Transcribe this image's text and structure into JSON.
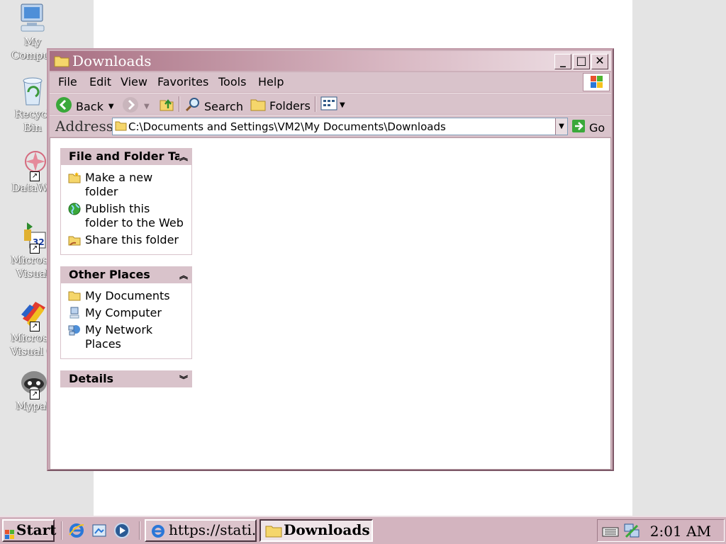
{
  "desktop": {
    "icons": [
      {
        "label": "My\nComput",
        "icon": "my-computer-icon"
      },
      {
        "label": "Recycl\nBin",
        "icon": "recycle-bin-icon"
      },
      {
        "label": "DataWa",
        "icon": "datawatch-icon"
      },
      {
        "label": "Microso\nVisual",
        "icon": "visual-studio-icon"
      },
      {
        "label": "Microso\nVisual C",
        "icon": "visual-c-icon"
      },
      {
        "label": "Mypal",
        "icon": "mypal-raccoon-icon"
      }
    ]
  },
  "window": {
    "title": "Downloads",
    "controls": {
      "minimize": "_",
      "maximize": "□",
      "close": "✕"
    },
    "menu": [
      "File",
      "Edit",
      "View",
      "Favorites",
      "Tools",
      "Help"
    ],
    "toolbar": {
      "back": "Back",
      "search": "Search",
      "folders": "Folders"
    },
    "address": {
      "label": "Address",
      "value": "C:\\Documents and Settings\\VM2\\My Documents\\Downloads",
      "go": "Go"
    },
    "tasks_panel": {
      "title": "File and Folder Ta",
      "items": [
        "Make a new\nfolder",
        "Publish this\nfolder to the Web",
        "Share this folder"
      ]
    },
    "places_panel": {
      "title": "Other Places",
      "items": [
        "My Documents",
        "My Computer",
        "My Network\nPlaces"
      ]
    },
    "details_panel": {
      "title": "Details"
    }
  },
  "taskbar": {
    "start": "Start",
    "tasks": [
      "https://stati...",
      "Downloads"
    ],
    "clock": "2:01 AM"
  },
  "colors": {
    "accent": "#d9c3cb",
    "title_start": "#a86f82",
    "desktop_gray": "#e4e4e4"
  }
}
